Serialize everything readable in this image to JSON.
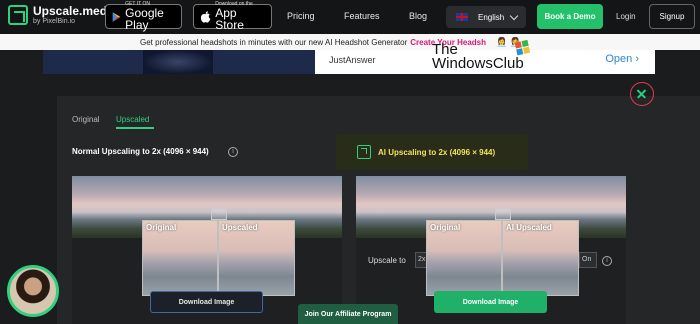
{
  "header": {
    "brand": "Upscale.media",
    "brand_sub": "by PixelBin.io",
    "google_play_small": "GET IT ON",
    "google_play_big": "Google Play",
    "app_store_small": "Download on the",
    "app_store_big": "App Store",
    "nav": [
      "Pricing",
      "Features",
      "Blog"
    ],
    "language": "English",
    "book_demo": "Book a Demo",
    "login": "Login",
    "signup": "Signup"
  },
  "ad": {
    "banner_text": "Get professional headshots in minutes with our new AI Headshot Generator",
    "banner_link": "Create Your Headsh",
    "sponsor": "JustAnswer",
    "open_label": "Open",
    "watermark_line1": "The",
    "watermark_line2": "WindowsClub"
  },
  "modal": {
    "tabs": [
      "Original",
      "Upscaled"
    ],
    "active_tab": "Upscaled",
    "normal_label": "Normal Upscaling to 2x (4096 × 944)",
    "ai_label": "AI Upscaling to 2x (4096 × 944)",
    "compare_original": "Original",
    "compare_upscaled": "Upscaled",
    "compare_ai_upscaled": "AI Upscaled",
    "download_label": "Download Image",
    "upscale_to_label": "Upscale to",
    "upscale_to_value": "2x",
    "toggle_value": "On"
  },
  "affiliate": "Join Our Affiliate Program",
  "colors": {
    "accent": "#2fd07e",
    "ai_text": "#f2e35a",
    "close_ring": "#e23b4b"
  }
}
